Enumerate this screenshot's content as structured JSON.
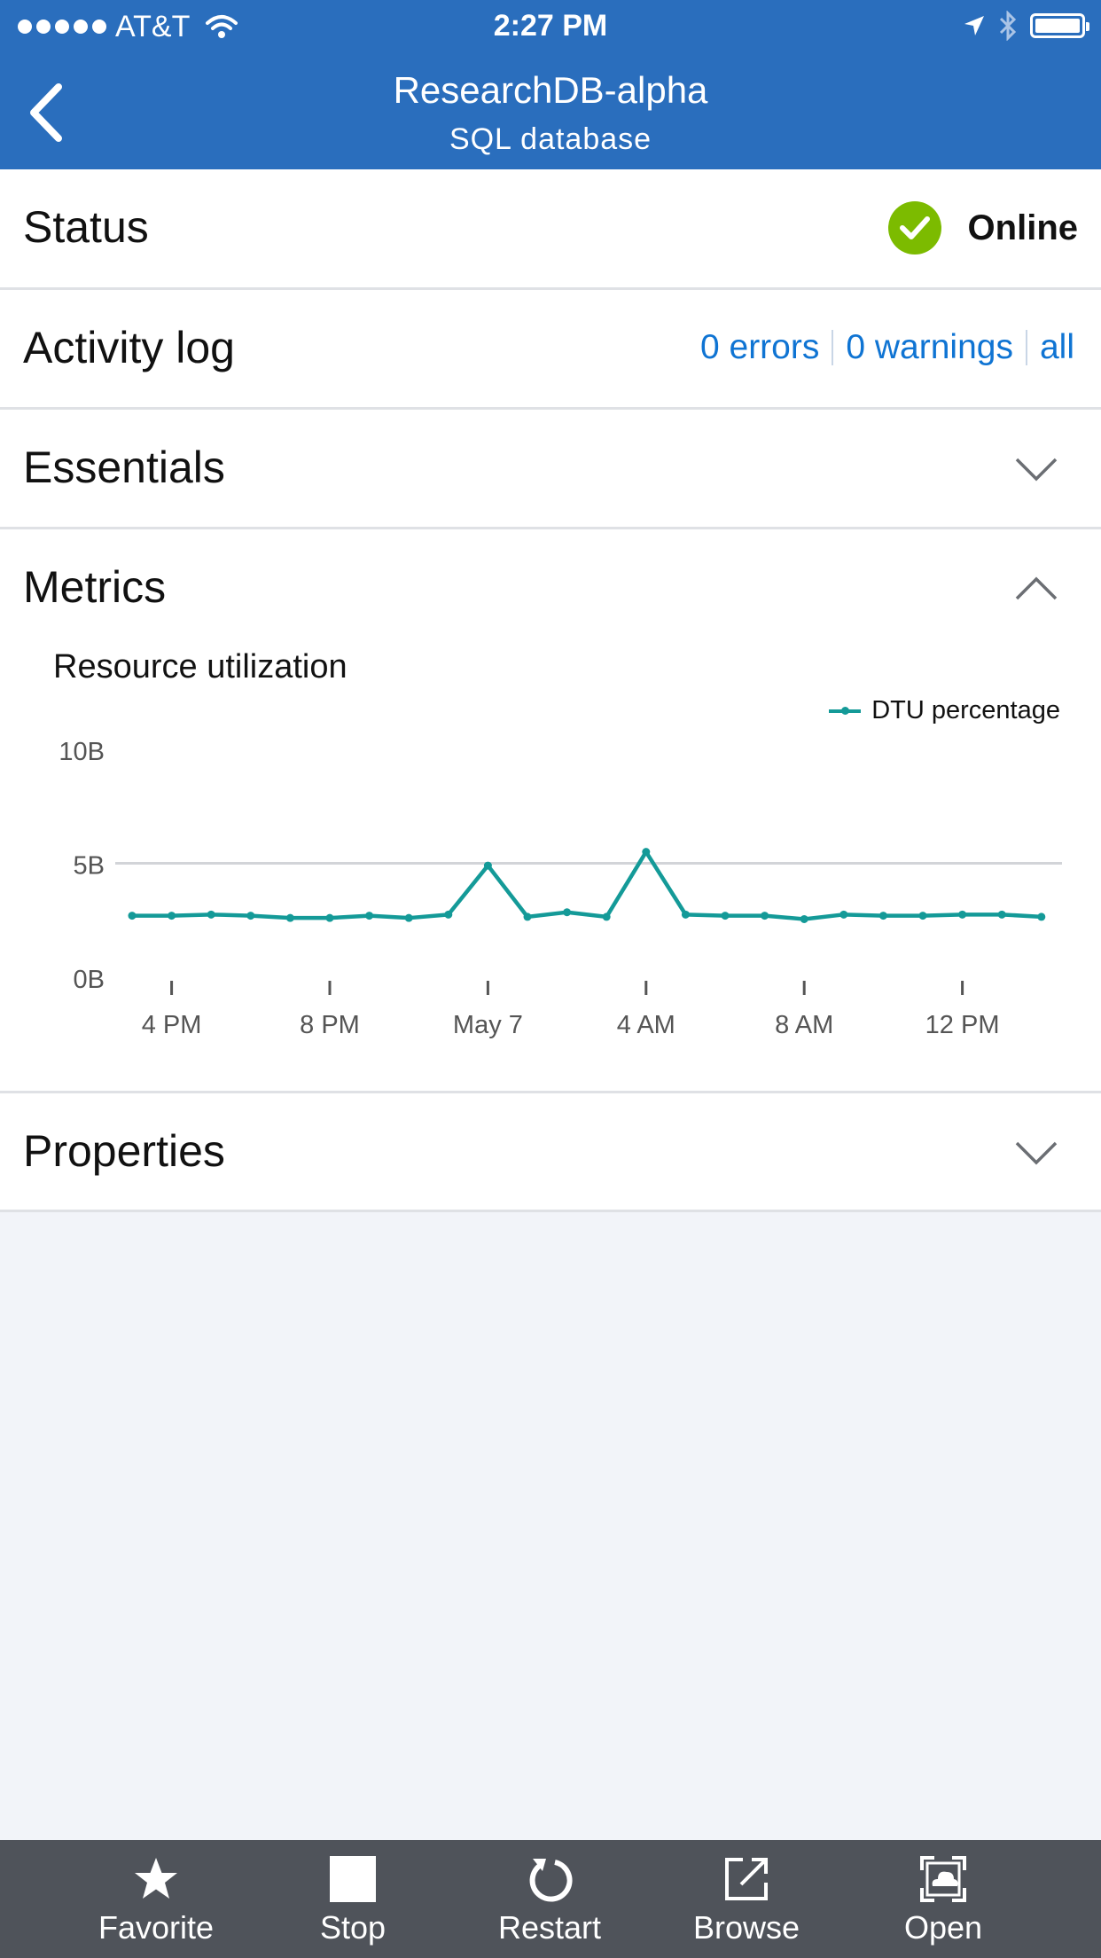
{
  "status_bar": {
    "carrier": "AT&T",
    "time": "2:27 PM"
  },
  "header": {
    "title": "ResearchDB-alpha",
    "subtitle": "SQL database"
  },
  "status": {
    "label": "Status",
    "value": "Online",
    "color": "#7cbb00"
  },
  "activity_log": {
    "label": "Activity log",
    "errors": "0 errors",
    "warnings": "0 warnings",
    "all": "all"
  },
  "essentials": {
    "label": "Essentials"
  },
  "metrics": {
    "label": "Metrics",
    "chart_title": "Resource utilization"
  },
  "properties": {
    "label": "Properties"
  },
  "toolbar": {
    "favorite": "Favorite",
    "stop": "Stop",
    "restart": "Restart",
    "browse": "Browse",
    "open": "Open"
  },
  "chart_data": {
    "type": "line",
    "title": "Resource utilization",
    "series": [
      {
        "name": "DTU percentage",
        "color": "#149a98",
        "x_hours": [
          0,
          1,
          2,
          3,
          4,
          5,
          6,
          7,
          8,
          9,
          10,
          11,
          12,
          13,
          14,
          15,
          16,
          17,
          18,
          19,
          20,
          21,
          22,
          23
        ],
        "values": [
          2.7,
          2.7,
          2.75,
          2.7,
          2.6,
          2.6,
          2.7,
          2.6,
          2.75,
          4.9,
          2.65,
          2.85,
          2.65,
          5.5,
          2.75,
          2.7,
          2.7,
          2.55,
          2.75,
          2.7,
          2.7,
          2.75,
          2.75,
          2.65
        ]
      }
    ],
    "x_ticks": [
      {
        "label": "4 PM",
        "hour": 1
      },
      {
        "label": "8 PM",
        "hour": 5
      },
      {
        "label": "May 7",
        "hour": 9
      },
      {
        "label": "4 AM",
        "hour": 13
      },
      {
        "label": "8 AM",
        "hour": 17
      },
      {
        "label": "12 PM",
        "hour": 21
      }
    ],
    "y_ticks": [
      "0B",
      "5B",
      "10B"
    ],
    "y_tick_values": [
      0,
      5,
      10
    ],
    "ylim": [
      0,
      10
    ],
    "grid": "horizontal line at 5B",
    "legend_position": "top-right"
  }
}
